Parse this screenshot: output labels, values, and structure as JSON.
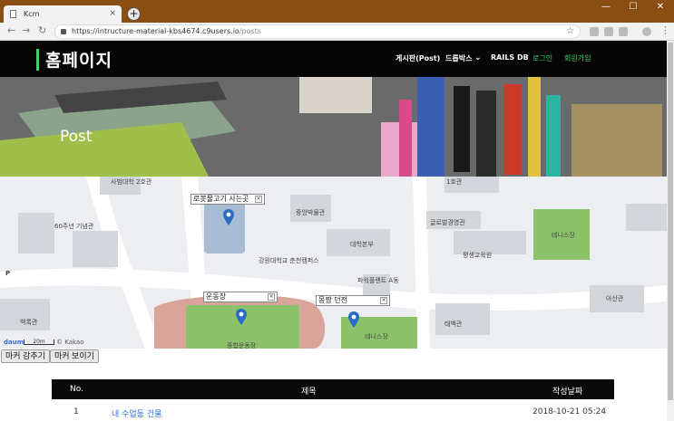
{
  "browser": {
    "tab_title": "Kcm",
    "tab_close": "×",
    "new_tab": "+",
    "url_host": "https://intructure-material-kbs4674.c9users.io",
    "url_path": "/posts",
    "window_controls": [
      "—",
      "☐",
      "✕"
    ]
  },
  "site": {
    "brand": "홈페이지",
    "nav": [
      "게시판(Post)",
      "드롭박스",
      "RAILS DB",
      "로그인",
      "회원가입"
    ],
    "nav_accent_color": "#3bd56a"
  },
  "hero": {
    "title": "Post"
  },
  "map": {
    "labels": [
      "사범대학 2호관",
      "60주년 기념관",
      "중앙박물관",
      "대학본부",
      "1호관",
      "글로벌경영관",
      "평생교육원",
      "테니스장",
      "강원대학교 춘천캠퍼스",
      "파워플랜트 A동",
      "백록관",
      "태백관",
      "아산관",
      "종합운동장",
      "테니스장",
      "P"
    ],
    "markers": [
      {
        "title": "로봇물고기 사는곳"
      },
      {
        "title": "운동장"
      },
      {
        "title": "몽짱 던전"
      }
    ],
    "close_glyph": "×",
    "scale": "20m",
    "logo": "daum",
    "copyright": "© Kakao"
  },
  "buttons": {
    "hide": "마커 감추기",
    "show": "마커 보이기"
  },
  "table": {
    "headers": [
      "No.",
      "제목",
      "작성날짜"
    ],
    "rows": [
      {
        "no": "1",
        "title": "내 수업동 건물",
        "date": "2018-10-21 05:24"
      }
    ]
  }
}
